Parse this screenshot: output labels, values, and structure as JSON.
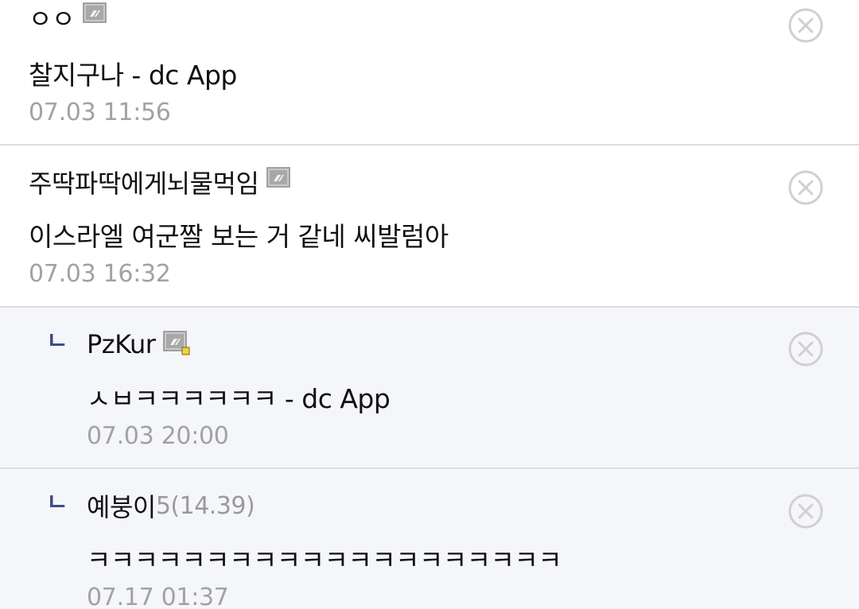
{
  "comments": [
    {
      "author": "ㅇㅇ",
      "author_meta": "",
      "text": "찰지구나 - dc App",
      "date": "07.03 11:56",
      "is_reply": false,
      "badge": "gallog-icon"
    },
    {
      "author": "주딱파딱에게뇌물먹임",
      "author_meta": "",
      "text": "이스라엘 여군짤 보는 거 같네 씨발럼아",
      "date": "07.03 16:32",
      "is_reply": false,
      "badge": "gallog-icon"
    },
    {
      "author": "PzKur",
      "author_meta": "",
      "text": "ㅅㅂㅋㅋㅋㅋㅋㅋ - dc App",
      "date": "07.03 20:00",
      "is_reply": true,
      "reply_mark": "ㄴ",
      "badge": "gallog-fixed-icon"
    },
    {
      "author": "예붕이",
      "author_meta": "5(14.39)",
      "text": "ㅋㅋㅋㅋㅋㅋㅋㅋㅋㅋㅋㅋㅋㅋㅋㅋㅋㅋㅋㅋ",
      "date": "07.17 01:37",
      "is_reply": true,
      "reply_mark": "ㄴ",
      "badge": ""
    }
  ],
  "icons": {
    "delete": "close-circle-icon",
    "reply": "reply-arrow-icon"
  },
  "colors": {
    "reply_mark": "#3f4a8a",
    "date": "#a2a2a2",
    "reply_background": "#f5f6fa",
    "divider": "#dedede",
    "delete_icon": "#d0d0d0"
  }
}
